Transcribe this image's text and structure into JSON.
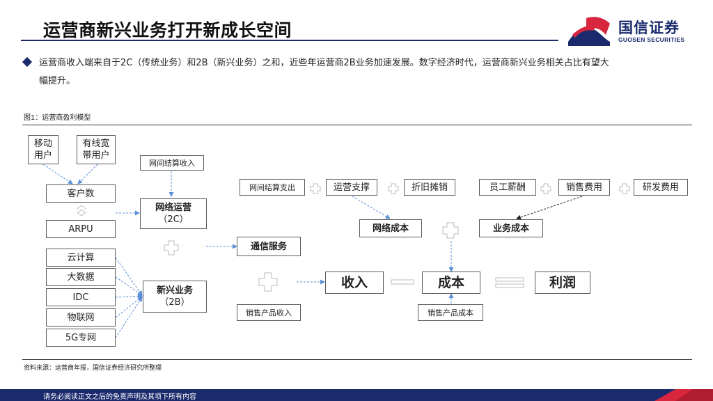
{
  "header": {
    "title": "运营商新兴业务打开新成长空间",
    "logo_cn": "国信证券",
    "logo_en": "GUOSEN SECURITIES"
  },
  "bullet": {
    "line1": "运营商收入端来自于2C（传统业务）和2B（新兴业务）之和，近些年运营商2B业务加速发展。数字经济时代，运营商新兴业务相关占比有望大",
    "line2": "幅提升。"
  },
  "figure": {
    "label": "图1：运营商盈利模型",
    "source": "资料来源：运营商年报，国信证券经济研究所整理"
  },
  "diagram": {
    "mobile_users_l1": "移动",
    "mobile_users_l2": "用户",
    "broadband_users_l1": "有线宽",
    "broadband_users_l2": "带用户",
    "customer_count": "客户数",
    "arpu": "ARPU",
    "network_settlement_income": "网间结算收入",
    "network_operation_l1": "网络运营",
    "network_operation_l2": "（2C）",
    "cloud_computing": "云计算",
    "big_data": "大数据",
    "idc": "IDC",
    "iot": "物联网",
    "private_5g": "5G专网",
    "emerging_business_l1": "新兴业务",
    "emerging_business_l2": "（2B）",
    "communication_service": "通信服务",
    "product_sales_income": "销售产品收入",
    "revenue": "收入",
    "cost": "成本",
    "profit": "利润",
    "product_sales_cost": "销售产品成本",
    "network_settlement_expense": "网间结算支出",
    "operation_support": "运营支撑",
    "depreciation": "折旧摊销",
    "staff_salary": "员工薪酬",
    "sales_expense": "销售费用",
    "rd_expense": "研发费用",
    "network_cost": "网络成本",
    "business_cost": "业务成本"
  },
  "footer": {
    "disclaimer": "请务必阅读正文之后的免责声明及其项下所有内容"
  },
  "colors": {
    "brand_navy": "#1a2a6c",
    "brand_red": "#d7263d",
    "arrow_blue": "#5b8fd6"
  }
}
